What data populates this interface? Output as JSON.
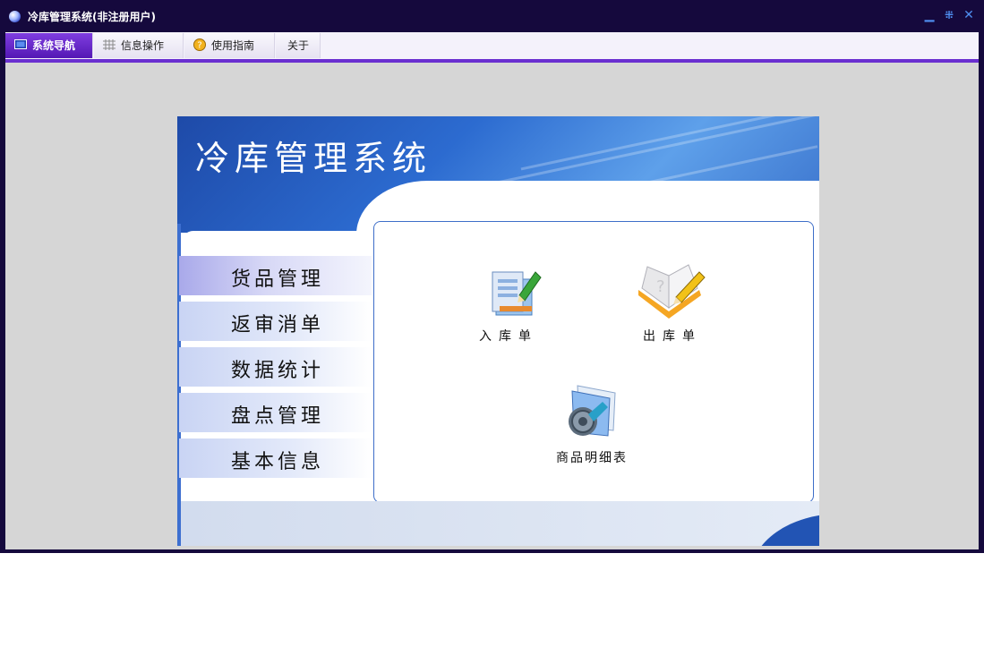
{
  "window": {
    "title": "冷库管理系统(非注册用户)",
    "controls": [
      "minimize",
      "restore",
      "close"
    ]
  },
  "menu": {
    "tabs": [
      {
        "label": "系统导航",
        "icon": "monitor-icon",
        "active": true
      },
      {
        "label": "信息操作",
        "icon": "grid-icon",
        "active": false
      },
      {
        "label": "使用指南",
        "icon": "help-icon",
        "active": false
      },
      {
        "label": "关于",
        "icon": "",
        "active": false
      }
    ]
  },
  "banner": {
    "title": "冷库管理系统"
  },
  "nav": {
    "items": [
      {
        "label": "货品管理",
        "active": true
      },
      {
        "label": "返审消单",
        "active": false
      },
      {
        "label": "数据统计",
        "active": false
      },
      {
        "label": "盘点管理",
        "active": false
      },
      {
        "label": "基本信息",
        "active": false
      }
    ]
  },
  "functions": [
    {
      "label": "入库单",
      "icon": "inbound-form-icon"
    },
    {
      "label": "出库单",
      "icon": "outbound-book-icon"
    },
    {
      "label": "商品明细表",
      "icon": "settings-folder-icon"
    }
  ],
  "colors": {
    "titlebar": "#15093d",
    "accent": "#6a2fd0",
    "banner_blue": "#2c6bd0",
    "window_button": "#4f8ef0"
  }
}
